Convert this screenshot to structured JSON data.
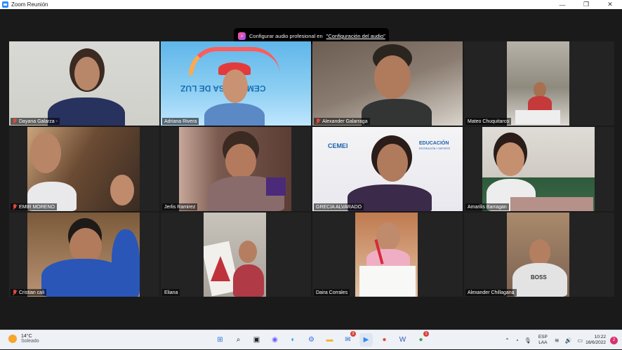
{
  "window": {
    "title": "Zoom Reunión",
    "controls": [
      "—",
      "❐",
      "✕"
    ]
  },
  "notice": {
    "text": "Configurar audio profesional en",
    "link": "\"Configuración del audio\""
  },
  "participants": [
    {
      "name": "Dayana Galarza -",
      "muted": true
    },
    {
      "name": "Adriana Rivera",
      "muted": false
    },
    {
      "name": "Alexander Galarraga",
      "muted": true
    },
    {
      "name": "Mateo Chuquitarco",
      "muted": false
    },
    {
      "name": "EMIR MORENO",
      "muted": true
    },
    {
      "name": "Jerlis Ramirez",
      "muted": false
    },
    {
      "name": "GRECIA ALVARADO",
      "muted": false,
      "speaking": true
    },
    {
      "name": "Amarilis Barragan",
      "muted": false
    },
    {
      "name": "Cristian cali",
      "muted": true
    },
    {
      "name": "Eliana",
      "muted": false
    },
    {
      "name": "Daira Corrales",
      "muted": false
    },
    {
      "name": "Alexander Chillagana",
      "muted": false
    }
  ],
  "scene_text": {
    "cemei_banner": "CEMEI CASA DE LUZ",
    "logo_cemei": "CEMEI",
    "logo_ministry": "EDUCACIÓN",
    "logo_ministry_sub": "RECREACIÓN Y DEPORTE",
    "shirt_text": "BOSS"
  },
  "taskbar": {
    "weather_temp": "14°C",
    "weather_cond": "Soleado",
    "language_1": "ESP",
    "language_2": "LAA",
    "time": "10:22",
    "date": "16/6/2022",
    "notifications": "2",
    "mail_badge": "2",
    "chrome_badge": "1"
  },
  "colors": {
    "stage": "#1a1a1a",
    "active_border": "#c9e34a",
    "mute_red": "#e0483e"
  }
}
